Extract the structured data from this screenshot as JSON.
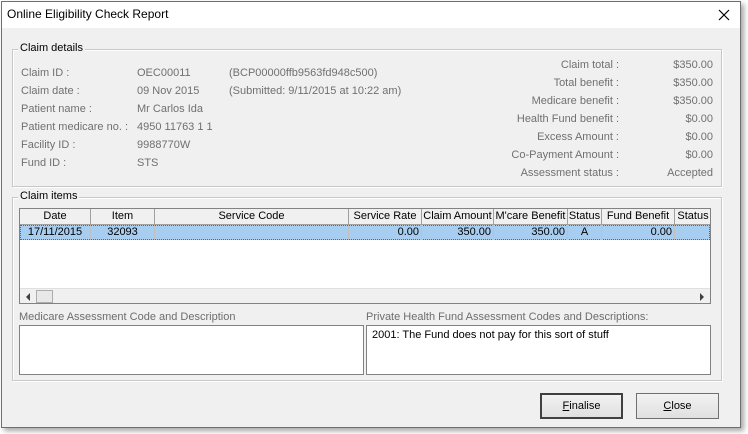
{
  "window": {
    "title": "Online Eligibility Check Report"
  },
  "claim_details": {
    "legend": "Claim details",
    "claim_id_label": "Claim ID :",
    "claim_id": "OEC00011",
    "claim_ref": "(BCP00000ffb9563fd948c500)",
    "claim_date_label": "Claim date :",
    "claim_date": "09 Nov 2015",
    "submitted": "(Submitted: 9/11/2015 at 10:22 am)",
    "patient_name_label": "Patient name :",
    "patient_name": "Mr Carlos Ida",
    "medicare_no_label": "Patient medicare no. :",
    "medicare_no": "4950 11763 1 1",
    "facility_id_label": "Facility ID :",
    "facility_id": "9988770W",
    "fund_id_label": "Fund ID :",
    "fund_id": "STS",
    "claim_total_label": "Claim total :",
    "claim_total": "$350.00",
    "total_benefit_label": "Total benefit :",
    "total_benefit": "$350.00",
    "medicare_benefit_label": "Medicare benefit :",
    "medicare_benefit": "$350.00",
    "health_fund_benefit_label": "Health Fund benefit :",
    "health_fund_benefit": "$0.00",
    "excess_amount_label": "Excess Amount :",
    "excess_amount": "$0.00",
    "copayment_label": "Co-Payment Amount :",
    "copayment": "$0.00",
    "assessment_status_label": "Assessment status :",
    "assessment_status": "Accepted"
  },
  "claim_items": {
    "legend": "Claim items",
    "columns": [
      "Date",
      "Item",
      "Service Code",
      "Service Rate",
      "Claim Amount",
      "M'care Benefit",
      "Status",
      "Fund Benefit",
      "Status"
    ],
    "rows": [
      [
        "17/11/2015",
        "32093",
        "",
        "0.00",
        "350.00",
        "350.00",
        "A",
        "0.00",
        ""
      ]
    ]
  },
  "medicare_assessment": {
    "label": "Medicare Assessment Code and Description",
    "text": ""
  },
  "private_assessment": {
    "label": "Private Health Fund Assessment Codes and Descriptions:",
    "text": "2001: The Fund does not pay for this sort of stuff"
  },
  "buttons": {
    "finalise_first": "F",
    "finalise_rest": "inalise",
    "close_first": "C",
    "close_rest": "lose"
  }
}
